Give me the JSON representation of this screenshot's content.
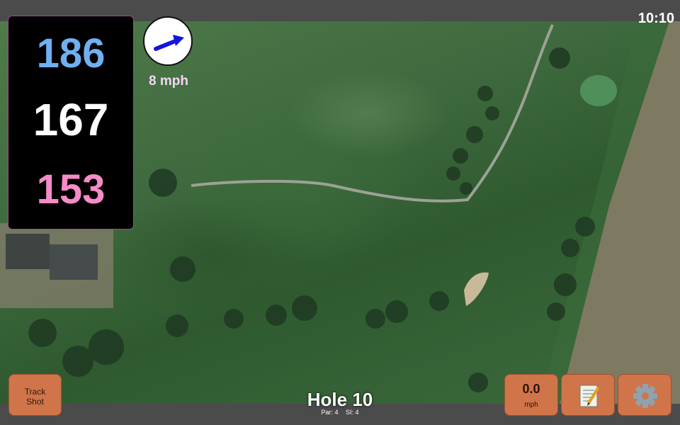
{
  "status": {
    "time": "10:10"
  },
  "yardages": {
    "back": "186",
    "middle": "167",
    "front": "153"
  },
  "wind": {
    "speed": "8 mph",
    "icon": "wind-arrow-icon"
  },
  "buttons": {
    "track_shot_line1": "Track",
    "track_shot_line2": "Shot",
    "speed_value": "0.0",
    "speed_unit": "mph",
    "notes_icon": "notepad-icon",
    "settings_icon": "gear-icon"
  },
  "hole": {
    "title": "Hole 10",
    "par": "Par: 4",
    "si": "SI: 4"
  },
  "colors": {
    "back": "#6fb0f1",
    "middle": "#ffffff",
    "front": "#f58bc7",
    "button": "#d0744a",
    "bar": "#4b4b4b"
  }
}
